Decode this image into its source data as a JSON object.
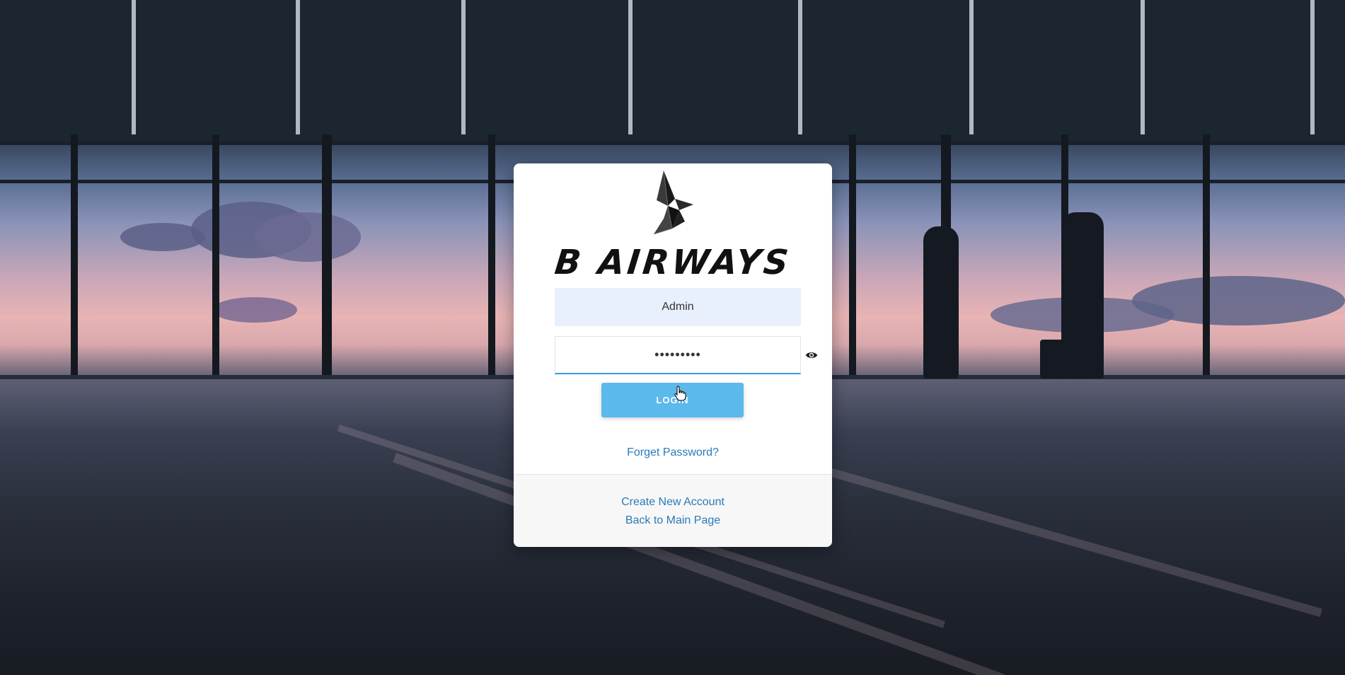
{
  "brand": {
    "name": "B AIRWAYS",
    "logo_icon": "origami-bird-icon"
  },
  "login_form": {
    "username_value": "Admin",
    "password_value": "•••••••••",
    "toggle_password_icon": "eye-icon",
    "login_label": "LOGIN",
    "forgot_password_label": "Forget Password?"
  },
  "footer": {
    "create_account_label": "Create New Account",
    "back_label": "Back to Main Page"
  },
  "colors": {
    "accent": "#5bb9ec",
    "link": "#2a7ab8",
    "input_filled_bg": "#e8f0fe",
    "input_focus_border": "#3a9ad9"
  }
}
